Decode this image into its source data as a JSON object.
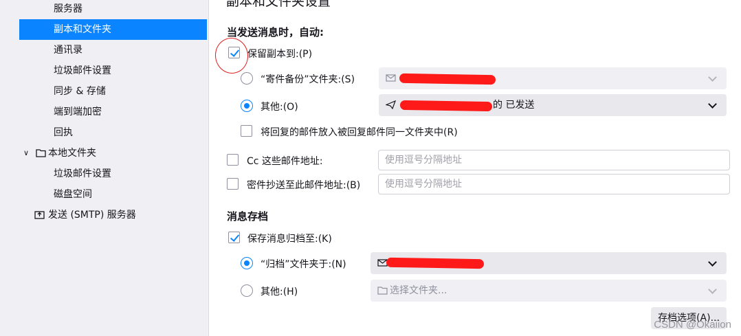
{
  "sidebar": {
    "items": [
      {
        "label": "服务器"
      },
      {
        "label": "副本和文件夹"
      },
      {
        "label": "通讯录"
      },
      {
        "label": "垃圾邮件设置"
      },
      {
        "label": "同步 & 存储"
      },
      {
        "label": "端到端加密"
      },
      {
        "label": "回执"
      },
      {
        "label": "本地文件夹"
      },
      {
        "label": "垃圾邮件设置"
      },
      {
        "label": "磁盘空间"
      },
      {
        "label": "发送 (SMTP) 服务器"
      }
    ]
  },
  "main": {
    "page_title": "副本和文件夹设置",
    "send_section": {
      "heading": "当发送消息时，自动:",
      "keep_copy_label": "保留副本到:(P)",
      "sent_folder_label": "“寄件备份”文件夹:(S)",
      "other_label": "其他:(O)",
      "other_value_suffix": "的 已发送",
      "reply_folder_label": "将回复的邮件放入被回复邮件同一文件夹中(R)",
      "cc_label": "Cc 这些邮件地址:",
      "cc_placeholder": "使用逗号分隔地址",
      "bcc_label": "密件抄送至此邮件地址:(B)",
      "bcc_placeholder": "使用逗号分隔地址"
    },
    "archive_section": {
      "heading": "消息存档",
      "keep_archive_label": "保存消息归档至:(K)",
      "archive_folder_label": "“归档”文件夹于:(N)",
      "other_label": "其他:(H)",
      "other_placeholder": "选择文件夹...",
      "options_button": "存档选项(A)..."
    }
  },
  "watermark": "CSDN @Okaiion",
  "colors": {
    "accent": "#0a84ff",
    "redaction": "#ff1a1a",
    "sidebar_bg": "#f0f0f4"
  }
}
